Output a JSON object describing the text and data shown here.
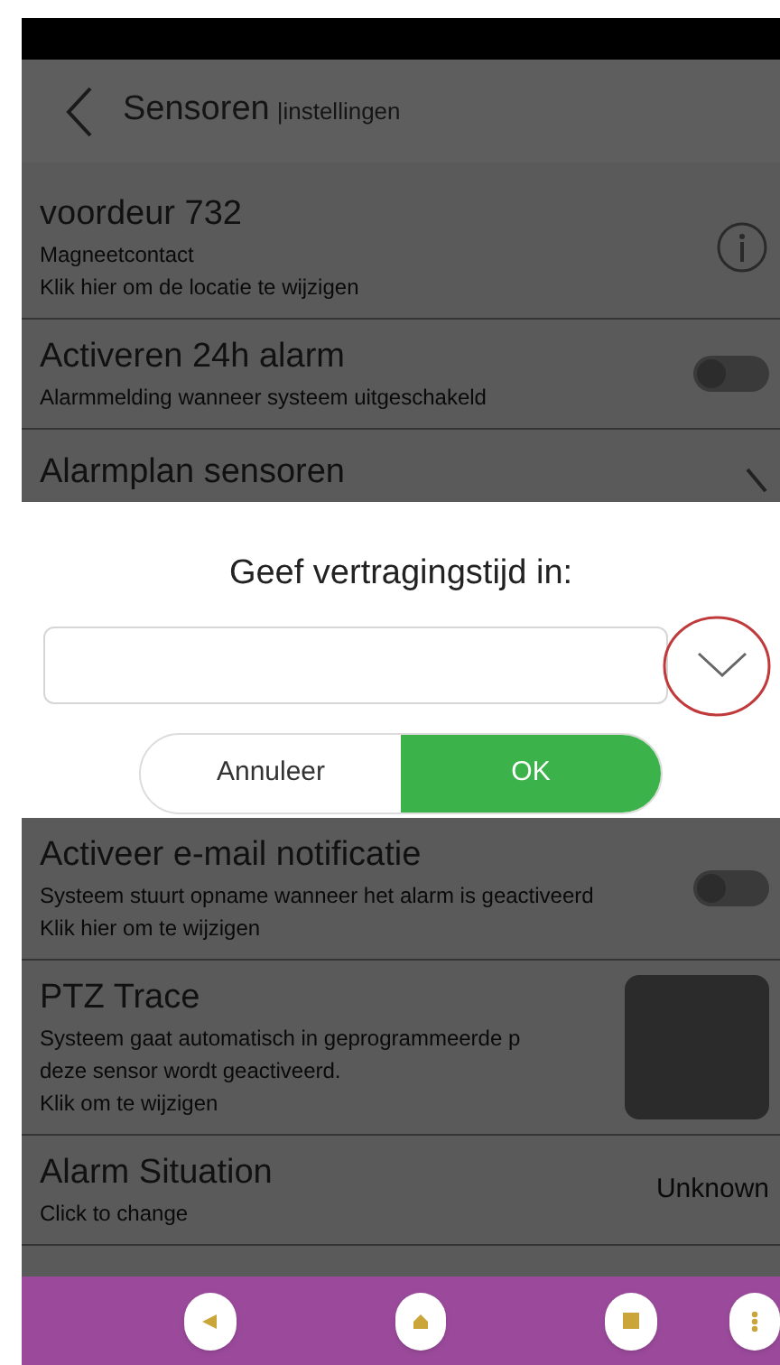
{
  "header": {
    "title": "Sensoren",
    "subtitle": "|instellingen"
  },
  "items_top": [
    {
      "kind": "info",
      "title": "voordeur 732",
      "lines": [
        "Magneetcontact",
        "Klik hier om de locatie te wijzigen"
      ]
    },
    {
      "kind": "toggle",
      "title": "Activeren 24h alarm",
      "lines": [
        "Alarmmelding wanneer systeem uitgeschakeld"
      ],
      "on": false
    },
    {
      "kind": "chevron",
      "title": "Alarmplan sensoren"
    }
  ],
  "dialog": {
    "title": "Geef vertragingstijd in:",
    "dropdown_highlighted": true,
    "buttons": [
      {
        "label": "Annuleer",
        "kind": "cancel"
      },
      {
        "label": "OK",
        "kind": "confirm"
      }
    ]
  },
  "items_bottom": [
    {
      "kind": "toggle",
      "title": "Activeer e-mail notificatie",
      "lines": [
        "Systeem stuurt opname wanneer het alarm is geactiveerd",
        "Klik hier om te wijzigen"
      ],
      "on": false
    },
    {
      "kind": "square",
      "title": "PTZ Trace",
      "lines": [
        "Systeem gaat automatisch in geprogrammeerde p",
        "deze sensor wordt geactiveerd.",
        "Klik om te wijzigen"
      ]
    },
    {
      "kind": "value",
      "title": "Alarm Situation",
      "lines": [
        "Click to change"
      ],
      "value": "Unknown"
    }
  ],
  "nav": [
    {
      "kind": "back"
    },
    {
      "kind": "home"
    },
    {
      "kind": "stop"
    },
    {
      "kind": "more"
    }
  ]
}
